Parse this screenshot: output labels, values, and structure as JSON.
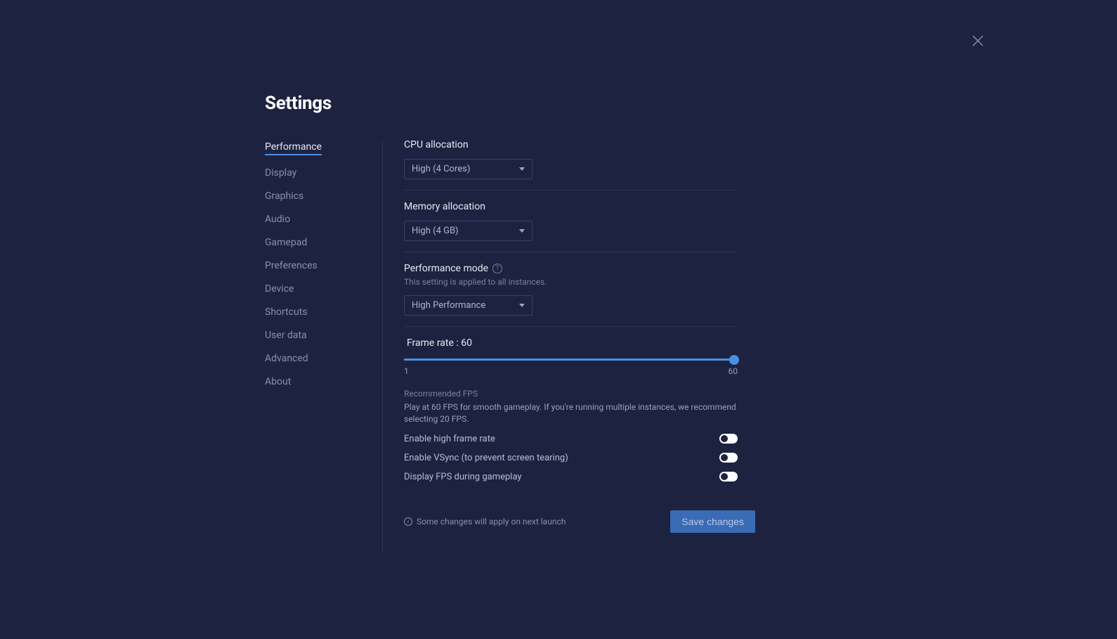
{
  "title": "Settings",
  "sidebar": {
    "items": [
      {
        "label": "Performance",
        "active": true
      },
      {
        "label": "Display",
        "active": false
      },
      {
        "label": "Graphics",
        "active": false
      },
      {
        "label": "Audio",
        "active": false
      },
      {
        "label": "Gamepad",
        "active": false
      },
      {
        "label": "Preferences",
        "active": false
      },
      {
        "label": "Device",
        "active": false
      },
      {
        "label": "Shortcuts",
        "active": false
      },
      {
        "label": "User data",
        "active": false
      },
      {
        "label": "Advanced",
        "active": false
      },
      {
        "label": "About",
        "active": false
      }
    ]
  },
  "cpu": {
    "label": "CPU allocation",
    "value": "High (4 Cores)"
  },
  "memory": {
    "label": "Memory allocation",
    "value": "High (4 GB)"
  },
  "perfmode": {
    "label": "Performance mode",
    "sublabel": "This setting is applied to all instances.",
    "value": "High Performance"
  },
  "framerate": {
    "label": "Frame rate : 60",
    "min": "1",
    "max": "60",
    "value": 60,
    "rec_title": "Recommended FPS",
    "rec_text": "Play at 60 FPS for smooth gameplay. If you're running multiple instances, we recommend selecting 20 FPS."
  },
  "toggles": {
    "highfps": {
      "label": "Enable high frame rate",
      "on": false
    },
    "vsync": {
      "label": "Enable VSync (to prevent screen tearing)",
      "on": false
    },
    "showfps": {
      "label": "Display FPS during gameplay",
      "on": false
    }
  },
  "footer": {
    "note": "Some changes will apply on next launch",
    "save": "Save changes"
  }
}
